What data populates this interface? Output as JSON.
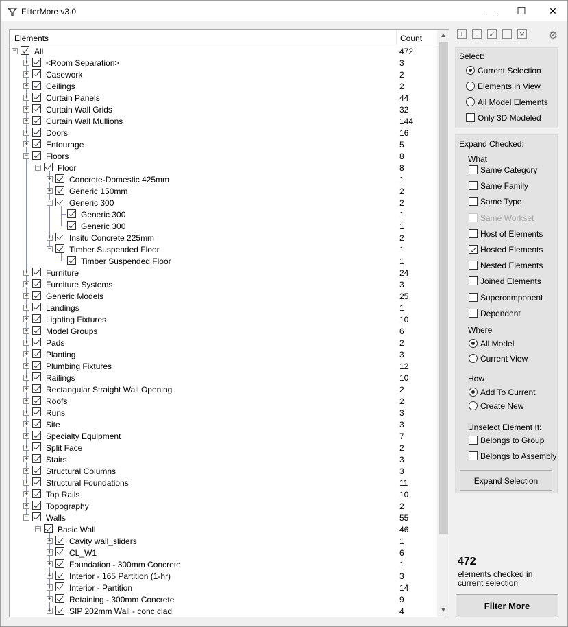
{
  "window": {
    "title": "FilterMore v3.0",
    "minimize": "—",
    "maximize": "☐",
    "close": "✕"
  },
  "tree": {
    "header_elements": "Elements",
    "header_count": "Count",
    "rows": [
      {
        "label": "All",
        "count": "472",
        "level": 0,
        "expander": "minus"
      },
      {
        "label": "<Room Separation>",
        "count": "3",
        "level": 1,
        "expander": "plus"
      },
      {
        "label": "Casework",
        "count": "2",
        "level": 1,
        "expander": "plus"
      },
      {
        "label": "Ceilings",
        "count": "2",
        "level": 1,
        "expander": "plus"
      },
      {
        "label": "Curtain Panels",
        "count": "44",
        "level": 1,
        "expander": "plus"
      },
      {
        "label": "Curtain Wall Grids",
        "count": "32",
        "level": 1,
        "expander": "plus"
      },
      {
        "label": "Curtain Wall Mullions",
        "count": "144",
        "level": 1,
        "expander": "plus"
      },
      {
        "label": "Doors",
        "count": "16",
        "level": 1,
        "expander": "plus"
      },
      {
        "label": "Entourage",
        "count": "5",
        "level": 1,
        "expander": "plus"
      },
      {
        "label": "Floors",
        "count": "8",
        "level": 1,
        "expander": "minus"
      },
      {
        "label": "Floor",
        "count": "8",
        "level": 2,
        "expander": "minus"
      },
      {
        "label": "Concrete-Domestic 425mm",
        "count": "1",
        "level": 3,
        "expander": "plus"
      },
      {
        "label": "Generic 150mm",
        "count": "2",
        "level": 3,
        "expander": "plus"
      },
      {
        "label": "Generic 300",
        "count": "2",
        "level": 3,
        "expander": "minus"
      },
      {
        "label": "Generic 300",
        "count": "1",
        "level": 4,
        "expander": "none"
      },
      {
        "label": "Generic 300",
        "count": "1",
        "level": 4,
        "expander": "none"
      },
      {
        "label": "Insitu Concrete 225mm",
        "count": "2",
        "level": 3,
        "expander": "plus"
      },
      {
        "label": "Timber Suspended Floor",
        "count": "1",
        "level": 3,
        "expander": "minus"
      },
      {
        "label": "Timber Suspended Floor",
        "count": "1",
        "level": 4,
        "expander": "none"
      },
      {
        "label": "Furniture",
        "count": "24",
        "level": 1,
        "expander": "plus"
      },
      {
        "label": "Furniture Systems",
        "count": "3",
        "level": 1,
        "expander": "plus"
      },
      {
        "label": "Generic Models",
        "count": "25",
        "level": 1,
        "expander": "plus"
      },
      {
        "label": "Landings",
        "count": "1",
        "level": 1,
        "expander": "plus"
      },
      {
        "label": "Lighting Fixtures",
        "count": "10",
        "level": 1,
        "expander": "plus"
      },
      {
        "label": "Model Groups",
        "count": "6",
        "level": 1,
        "expander": "plus"
      },
      {
        "label": "Pads",
        "count": "2",
        "level": 1,
        "expander": "plus"
      },
      {
        "label": "Planting",
        "count": "3",
        "level": 1,
        "expander": "plus"
      },
      {
        "label": "Plumbing Fixtures",
        "count": "12",
        "level": 1,
        "expander": "plus"
      },
      {
        "label": "Railings",
        "count": "10",
        "level": 1,
        "expander": "plus"
      },
      {
        "label": "Rectangular Straight Wall Opening",
        "count": "2",
        "level": 1,
        "expander": "plus"
      },
      {
        "label": "Roofs",
        "count": "2",
        "level": 1,
        "expander": "plus"
      },
      {
        "label": "Runs",
        "count": "3",
        "level": 1,
        "expander": "plus"
      },
      {
        "label": "Site",
        "count": "3",
        "level": 1,
        "expander": "plus"
      },
      {
        "label": "Specialty Equipment",
        "count": "7",
        "level": 1,
        "expander": "plus"
      },
      {
        "label": "Split Face",
        "count": "2",
        "level": 1,
        "expander": "plus"
      },
      {
        "label": "Stairs",
        "count": "3",
        "level": 1,
        "expander": "plus"
      },
      {
        "label": "Structural Columns",
        "count": "3",
        "level": 1,
        "expander": "plus"
      },
      {
        "label": "Structural Foundations",
        "count": "11",
        "level": 1,
        "expander": "plus"
      },
      {
        "label": "Top Rails",
        "count": "10",
        "level": 1,
        "expander": "plus"
      },
      {
        "label": "Topography",
        "count": "2",
        "level": 1,
        "expander": "plus"
      },
      {
        "label": "Walls",
        "count": "55",
        "level": 1,
        "expander": "minus"
      },
      {
        "label": "Basic Wall",
        "count": "46",
        "level": 2,
        "expander": "minus"
      },
      {
        "label": "Cavity wall_sliders",
        "count": "1",
        "level": 3,
        "expander": "plus"
      },
      {
        "label": "CL_W1",
        "count": "6",
        "level": 3,
        "expander": "plus"
      },
      {
        "label": "Foundation - 300mm Concrete",
        "count": "1",
        "level": 3,
        "expander": "plus"
      },
      {
        "label": "Interior - 165 Partition (1-hr)",
        "count": "3",
        "level": 3,
        "expander": "plus"
      },
      {
        "label": "Interior - Partition",
        "count": "14",
        "level": 3,
        "expander": "plus"
      },
      {
        "label": "Retaining - 300mm Concrete",
        "count": "9",
        "level": 3,
        "expander": "plus"
      },
      {
        "label": "SIP 202mm Wall - conc clad",
        "count": "4",
        "level": 3,
        "expander": "plus"
      }
    ]
  },
  "toolbar": {
    "icons": [
      "expand-all-icon",
      "collapse-all-icon",
      "check-all-icon",
      "uncheck-all-icon",
      "clear-icon"
    ],
    "settings": "gear-icon"
  },
  "select": {
    "title": "Select:",
    "options": [
      {
        "label": "Current Selection",
        "type": "radio",
        "on": true
      },
      {
        "label": "Elements in View",
        "type": "radio",
        "on": false
      },
      {
        "label": "All Model Elements",
        "type": "radio",
        "on": false
      },
      {
        "label": "Only 3D Modeled",
        "type": "check",
        "on": false
      }
    ]
  },
  "expand": {
    "title": "Expand Checked:",
    "what_label": "What",
    "what": [
      {
        "label": "Same Category",
        "on": false,
        "disabled": false
      },
      {
        "label": "Same Family",
        "on": false,
        "disabled": false
      },
      {
        "label": "Same Type",
        "on": false,
        "disabled": false
      },
      {
        "label": "Same Workset",
        "on": false,
        "disabled": true
      },
      {
        "label": "Host of Elements",
        "on": false,
        "disabled": false
      },
      {
        "label": "Hosted Elements",
        "on": true,
        "disabled": false
      },
      {
        "label": "Nested Elements",
        "on": false,
        "disabled": false
      },
      {
        "label": "Joined Elements",
        "on": false,
        "disabled": false
      },
      {
        "label": "Supercomponent",
        "on": false,
        "disabled": false
      },
      {
        "label": "Dependent",
        "on": false,
        "disabled": false
      }
    ],
    "where_label": "Where",
    "where": [
      {
        "label": "All Model",
        "on": true
      },
      {
        "label": "Current View",
        "on": false
      }
    ],
    "how_label": "How",
    "how": [
      {
        "label": "Add To Current",
        "on": true
      },
      {
        "label": "Create New",
        "on": false
      }
    ],
    "unselect_label": "Unselect Element If:",
    "unselect": [
      {
        "label": "Belongs to Group",
        "on": false
      },
      {
        "label": "Belongs to Assembly",
        "on": false
      }
    ],
    "button": "Expand Selection"
  },
  "summary": {
    "count": "472",
    "desc": "elements checked in current selection"
  },
  "filter_button": "Filter More"
}
